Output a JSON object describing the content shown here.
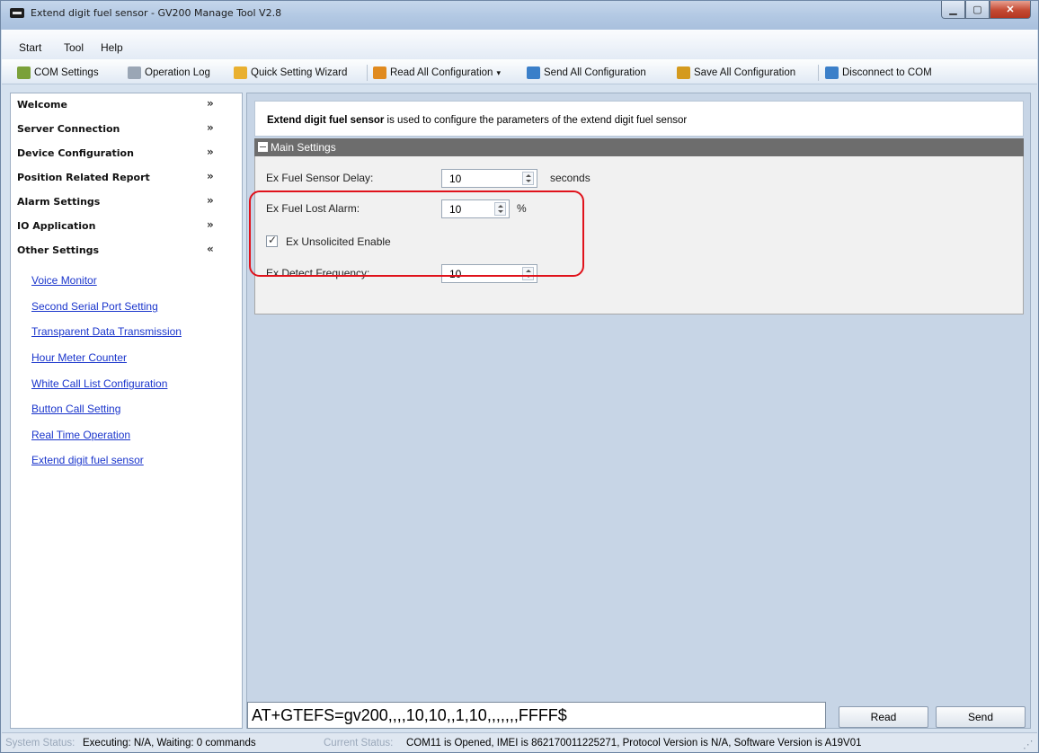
{
  "window": {
    "title": "Extend digit fuel sensor - GV200 Manage Tool V2.8"
  },
  "menu": [
    "Start",
    "Tool",
    "Help"
  ],
  "toolbar": [
    {
      "label": "COM Settings",
      "icon": "gear-icon",
      "color": "#7ba13a"
    },
    {
      "label": "Operation Log",
      "icon": "log-icon",
      "color": "#9aa6b5"
    },
    {
      "label": "Quick Setting Wizard",
      "icon": "wizard-icon",
      "color": "#e9b030"
    },
    {
      "label": "Read All Configuration",
      "icon": "read-icon",
      "color": "#e08a1f"
    },
    {
      "label": "Send All Configuration",
      "icon": "send-icon",
      "color": "#3b7fc9"
    },
    {
      "label": "Save All Configuration",
      "icon": "save-icon",
      "color": "#d49a1e"
    },
    {
      "label": "Disconnect to COM",
      "icon": "disconnect-icon",
      "color": "#3b7fc9"
    }
  ],
  "sidebar": {
    "sections": [
      {
        "label": "Welcome",
        "chevron": "»"
      },
      {
        "label": "Server Connection",
        "chevron": "»"
      },
      {
        "label": "Device Configuration",
        "chevron": "»"
      },
      {
        "label": "Position Related Report",
        "chevron": "»"
      },
      {
        "label": "Alarm Settings",
        "chevron": "»"
      },
      {
        "label": "IO Application",
        "chevron": "»"
      },
      {
        "label": "Other Settings",
        "chevron": "«"
      }
    ],
    "links": [
      "Voice Monitor",
      "Second Serial Port Setting",
      "Transparent Data Transmission",
      "Hour Meter Counter",
      "White Call List Configuration",
      "Button Call Setting",
      "Real Time Operation",
      "Extend digit fuel sensor"
    ]
  },
  "main": {
    "desc_bold": "Extend digit fuel sensor",
    "desc_rest": " is used to configure the parameters of the extend digit fuel sensor",
    "group_title": "Main Settings",
    "fields": {
      "delay_label": "Ex Fuel Sensor Delay:",
      "delay_value": "10",
      "delay_unit": "seconds",
      "lost_label": "Ex Fuel Lost Alarm:",
      "lost_value": "10",
      "lost_unit": "%",
      "unsolicited_label": "Ex Unsolicited Enable",
      "unsolicited_checked": true,
      "freq_label": "Ex Detect Frequency:",
      "freq_value": "10"
    },
    "command": "AT+GTEFS=gv200,,,,10,10,,1,10,,,,,,,FFFF$",
    "read_label": "Read",
    "send_label": "Send"
  },
  "status": {
    "sys_label": "System Status:",
    "sys_value": "Executing: N/A, Waiting: 0 commands",
    "cur_label": "Current Status:",
    "cur_value": "COM11 is Opened, IMEI is 862170011225271, Protocol Version is N/A, Software Version is A19V01"
  },
  "colors": {
    "highlight": "#e0121b",
    "link": "#1a35cc",
    "group_header": "#6d6d6d"
  }
}
